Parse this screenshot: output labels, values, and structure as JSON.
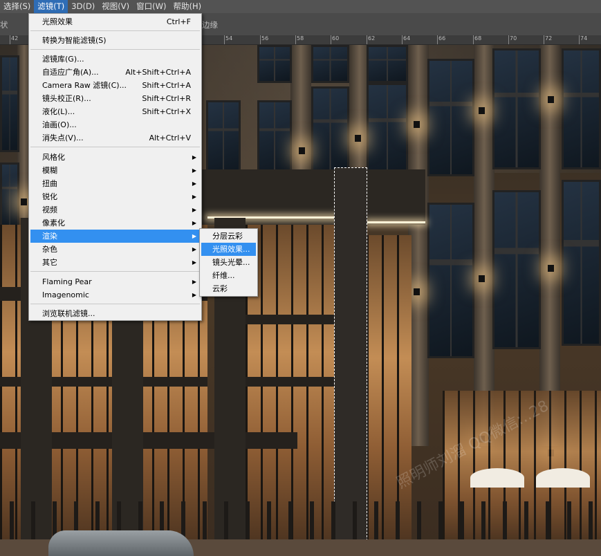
{
  "menubar": {
    "items": [
      "选择(S)",
      "滤镜(T)",
      "3D(D)",
      "视图(V)",
      "窗口(W)",
      "帮助(H)"
    ],
    "active_index": 1
  },
  "optionsbar": {
    "left_text": "状",
    "right_text": "边缘"
  },
  "ruler": {
    "labels": [
      "42",
      "54",
      "56",
      "58",
      "60",
      "62",
      "64",
      "66",
      "68",
      "70",
      "72",
      "74"
    ]
  },
  "filter_menu": {
    "items": [
      {
        "label": "光照效果",
        "shortcut": "Ctrl+F"
      },
      {
        "label": "转换为智能滤镜(S)",
        "shortcut": ""
      },
      {
        "label": "滤镜库(G)...",
        "shortcut": ""
      },
      {
        "label": "自适应广角(A)...",
        "shortcut": "Alt+Shift+Ctrl+A"
      },
      {
        "label": "Camera Raw 滤镜(C)...",
        "shortcut": "Shift+Ctrl+A"
      },
      {
        "label": "镜头校正(R)...",
        "shortcut": "Shift+Ctrl+R"
      },
      {
        "label": "液化(L)...",
        "shortcut": "Shift+Ctrl+X"
      },
      {
        "label": "油画(O)...",
        "shortcut": ""
      },
      {
        "label": "消失点(V)...",
        "shortcut": "Alt+Ctrl+V"
      },
      {
        "label": "风格化",
        "shortcut": ""
      },
      {
        "label": "模糊",
        "shortcut": ""
      },
      {
        "label": "扭曲",
        "shortcut": ""
      },
      {
        "label": "锐化",
        "shortcut": ""
      },
      {
        "label": "视频",
        "shortcut": ""
      },
      {
        "label": "像素化",
        "shortcut": ""
      },
      {
        "label": "渲染",
        "shortcut": ""
      },
      {
        "label": "杂色",
        "shortcut": ""
      },
      {
        "label": "其它",
        "shortcut": ""
      },
      {
        "label": "Flaming Pear",
        "shortcut": ""
      },
      {
        "label": "Imagenomic",
        "shortcut": ""
      },
      {
        "label": "浏览联机滤镜...",
        "shortcut": ""
      }
    ],
    "highlighted": "渲染"
  },
  "render_submenu": {
    "items": [
      "分层云彩",
      "光照效果...",
      "镜头光晕...",
      "纤维...",
      "云彩"
    ],
    "highlighted": "光照效果..."
  },
  "watermark": {
    "text": "照明师刘溜 QQ微信:..28"
  },
  "colors": {
    "highlight": "#3390f0",
    "menubar_bg": "#535353",
    "menu_bg": "#f0f0f0"
  }
}
